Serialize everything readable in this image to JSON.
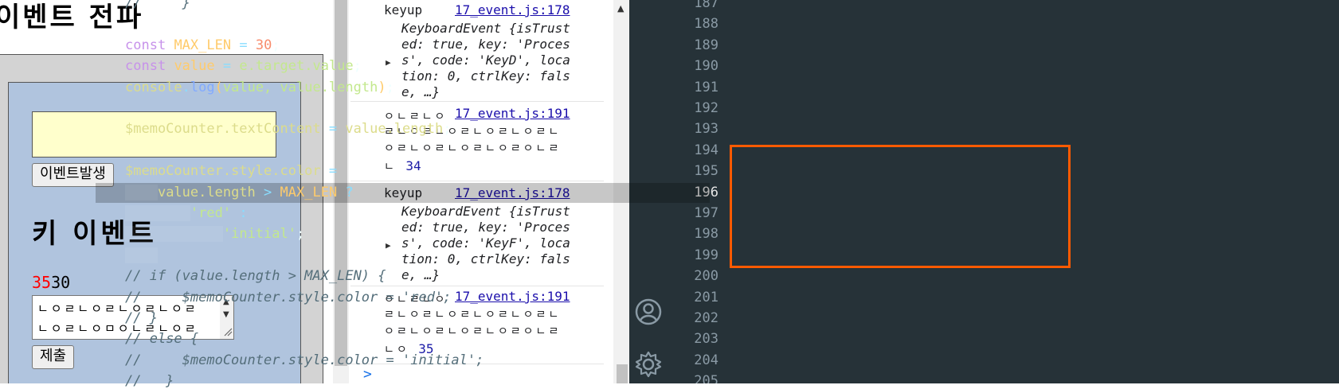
{
  "page": {
    "title": "이벤트 전파",
    "fire_button": "이벤트발생",
    "key_title": "키 이벤트",
    "counter_current": "35",
    "counter_max": "30",
    "memo_value": "ㄴㅇㄹㄴㅇㄹㄴㅇㄹㄴㅇㄹ\nㄴㅇㄹㄴㅇㅁㅇㄴㄹㄴㅇㄹ",
    "submit_button": "제출"
  },
  "console": {
    "entries": [
      {
        "type": "object",
        "event": "keyup",
        "source": "17_event.js:178",
        "lines": [
          "KeyboardEvent {isTrust",
          "ed: true, key: 'Proces",
          "s', code: 'KeyD', loca",
          "tion: 0, ctrlKey: fals",
          "e, …}"
        ]
      },
      {
        "type": "text",
        "event": "ㅇㄴㄹㄴㅇ",
        "source": "17_event.js:191",
        "lines": [
          "ㄹㄴㅇㄹㄴㅇㄹㄴㅇㄹㄴㅇㄹㄴ",
          "ㅇㄹㄴㅇㄹㄴㅇㄹㄴㅇㄹㅇㄴㄹ",
          "ㄴ"
        ],
        "count": "34"
      },
      {
        "type": "object",
        "event": "keyup",
        "source": "17_event.js:178",
        "lines": [
          "KeyboardEvent {isTrust",
          "ed: true, key: 'Proces",
          "s', code: 'KeyF', loca",
          "tion: 0, ctrlKey: fals",
          "e, …}"
        ]
      },
      {
        "type": "text",
        "event": "ㅇㄴㄹㄴㅇ",
        "source": "17_event.js:191",
        "lines": [
          "ㄹㄴㅇㄹㄴㅇㄹㄴㅇㄹㄴㅇㄹㄴ",
          "ㅇㄹㄴㅇㄹㄴㅇㄹㄴㅇㄹㅇㄴㄹ",
          "ㄴㅇ"
        ],
        "count": "35"
      }
    ],
    "prompt": ">"
  },
  "editor": {
    "line_numbers": [
      "187",
      "188",
      "189",
      "190",
      "191",
      "192",
      "193",
      "194",
      "195",
      "196",
      "197",
      "198",
      "199",
      "200",
      "201",
      "202",
      "203",
      "204",
      "205"
    ],
    "active_line": "196",
    "lines": {
      "l187": "//     }",
      "l189_kw": "const",
      "l189_name": "MAX_LEN",
      "l189_val": "30",
      "l190_kw": "const",
      "l190_name": "value",
      "l190_expr": "e.target.value",
      "l191_obj": "console",
      "l191_fn": "log",
      "l191_args": "value, value.length",
      "l193_obj": "$memoCounter",
      "l193_prop": ".textContent",
      "l193_rhs": "value.length",
      "l195_obj": "$memoCounter",
      "l195_prop": ".style.color",
      "l196_lhs": "value.length",
      "l196_op": ">",
      "l196_rhs": "MAX_LEN",
      "l196_q": "?",
      "l197_str": "'red'",
      "l198_str": "'initial'",
      "l200": "// if (value.length > MAX_LEN) {",
      "l201": "//     $memoCounter.style.color = 'red';",
      "l202": "// }",
      "l203": "// else {",
      "l204": "//     $memoCounter.style.color = 'initial';",
      "l205": "//   }"
    }
  },
  "colors": {
    "highlight_box": "#ff5a00",
    "editor_bg": "#263238",
    "counter_over": "#ff0000"
  }
}
